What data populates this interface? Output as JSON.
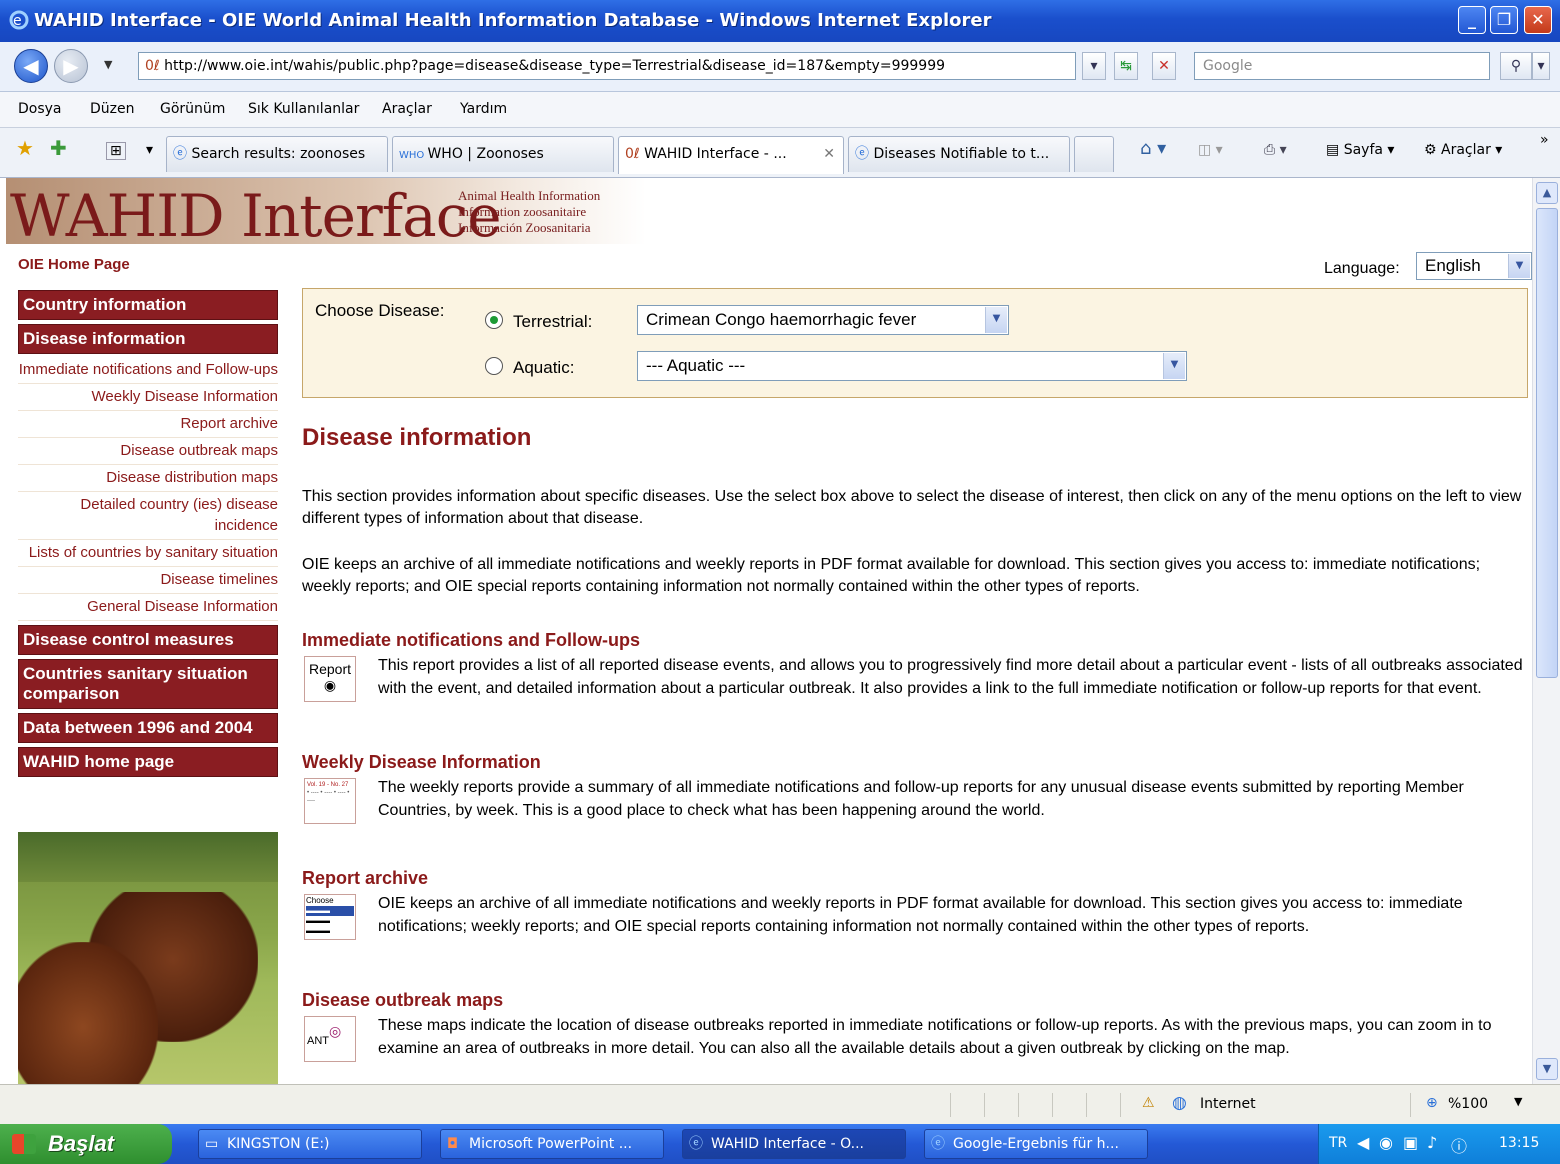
{
  "window": {
    "title": "WAHID Interface - OIE World Animal Health Information Database - Windows Internet Explorer",
    "controls": [
      "_",
      "❐",
      "✕"
    ]
  },
  "addressbar": {
    "url": "http://www.oie.int/wahis/public.php?page=disease&disease_type=Terrestrial&disease_id=187&empty=999999",
    "search_placeholder": "Google"
  },
  "menu": [
    "Dosya",
    "Düzen",
    "Görünüm",
    "Sık Kullanılanlar",
    "Araçlar",
    "Yardım"
  ],
  "tabs": [
    {
      "label": "Search results: zoonoses"
    },
    {
      "label": "WHO | Zoonoses"
    },
    {
      "label": "WAHID Interface - ..."
    },
    {
      "label": "Diseases Notifiable to t..."
    }
  ],
  "commandbar": {
    "page": "Sayfa",
    "tools": "Araçlar"
  },
  "banner": {
    "logo": "WAHID Interface",
    "sub": [
      "Animal Health Information",
      "Information zoosanitaire",
      "Información Zoosanitaria"
    ]
  },
  "header": {
    "home_link": "OIE Home Page",
    "language_label": "Language:",
    "language_value": "English"
  },
  "sidebar": {
    "items": [
      {
        "label": "Country information",
        "type": "head"
      },
      {
        "label": "Disease information",
        "type": "head"
      },
      {
        "label": "Immediate notifications and Follow-ups",
        "type": "sub"
      },
      {
        "label": "Weekly Disease Information",
        "type": "sub"
      },
      {
        "label": "Report archive",
        "type": "sub"
      },
      {
        "label": "Disease outbreak maps",
        "type": "sub"
      },
      {
        "label": "Disease distribution maps",
        "type": "sub"
      },
      {
        "label": "Detailed country (ies) disease incidence",
        "type": "sub"
      },
      {
        "label": "Lists of countries by sanitary situation",
        "type": "sub"
      },
      {
        "label": "Disease timelines",
        "type": "sub"
      },
      {
        "label": "General Disease Information",
        "type": "sub"
      },
      {
        "label": "Disease control measures",
        "type": "head"
      },
      {
        "label": "Countries sanitary situation comparison",
        "type": "head"
      },
      {
        "label": "Data between 1996 and 2004",
        "type": "head"
      },
      {
        "label": "WAHID home page",
        "type": "head"
      }
    ]
  },
  "chooser": {
    "label": "Choose Disease:",
    "terrestrial_label": "Terrestrial:",
    "terrestrial_value": "Crimean Congo haemorrhagic fever",
    "aquatic_label": "Aquatic:",
    "aquatic_value": "--- Aquatic ---"
  },
  "main": {
    "title": "Disease information",
    "intro1": "This section provides information about specific diseases. Use the select box above to select the disease of interest, then click on any of the menu options on the left to view different types of information about that disease.",
    "intro2": "OIE keeps an archive of all immediate notifications and weekly reports in PDF format available for download. This section gives you access to: immediate notifications; weekly reports; and OIE special reports containing information not normally contained within the other types of reports.",
    "sections": [
      {
        "title": "Immediate notifications and Follow-ups",
        "icon_label": "Report",
        "text": "This report provides a list of all reported disease events, and allows you to progressively find more detail about a particular event - lists of all outbreaks associated with the event, and detailed information about a particular outbreak. It also provides a link to the full immediate notification or follow-up reports for that event."
      },
      {
        "title": "Weekly Disease Information",
        "icon_label": "Vol. 19 - No. 27",
        "text": "The weekly reports provide a summary of all immediate notifications and follow-up reports for any unusual disease events submitted by reporting Member Countries, by week. This is a good place to check what has been happening around the world."
      },
      {
        "title": "Report archive",
        "icon_label": "Choose",
        "text": "OIE keeps an archive of all immediate notifications and weekly reports in PDF format available for download. This section gives you access to: immediate notifications; weekly reports; and OIE special reports containing information not normally contained within the other types of reports."
      },
      {
        "title": "Disease outbreak maps",
        "icon_label": "ANT",
        "text": "These maps indicate the location of disease outbreaks reported in immediate notifications or follow-up reports. As with the previous maps, you can zoom in to examine an area of outbreaks in more detail. You can also all the available details about a given outbreak by clicking on the map."
      }
    ]
  },
  "statusbar": {
    "zone": "Internet",
    "zoom": "%100"
  },
  "taskbar": {
    "start": "Başlat",
    "tasks": [
      "KINGSTON (E:)",
      "Microsoft PowerPoint ...",
      "WAHID Interface - O...",
      "Google-Ergebnis für h..."
    ],
    "lang": "TR",
    "time": "13:15"
  }
}
